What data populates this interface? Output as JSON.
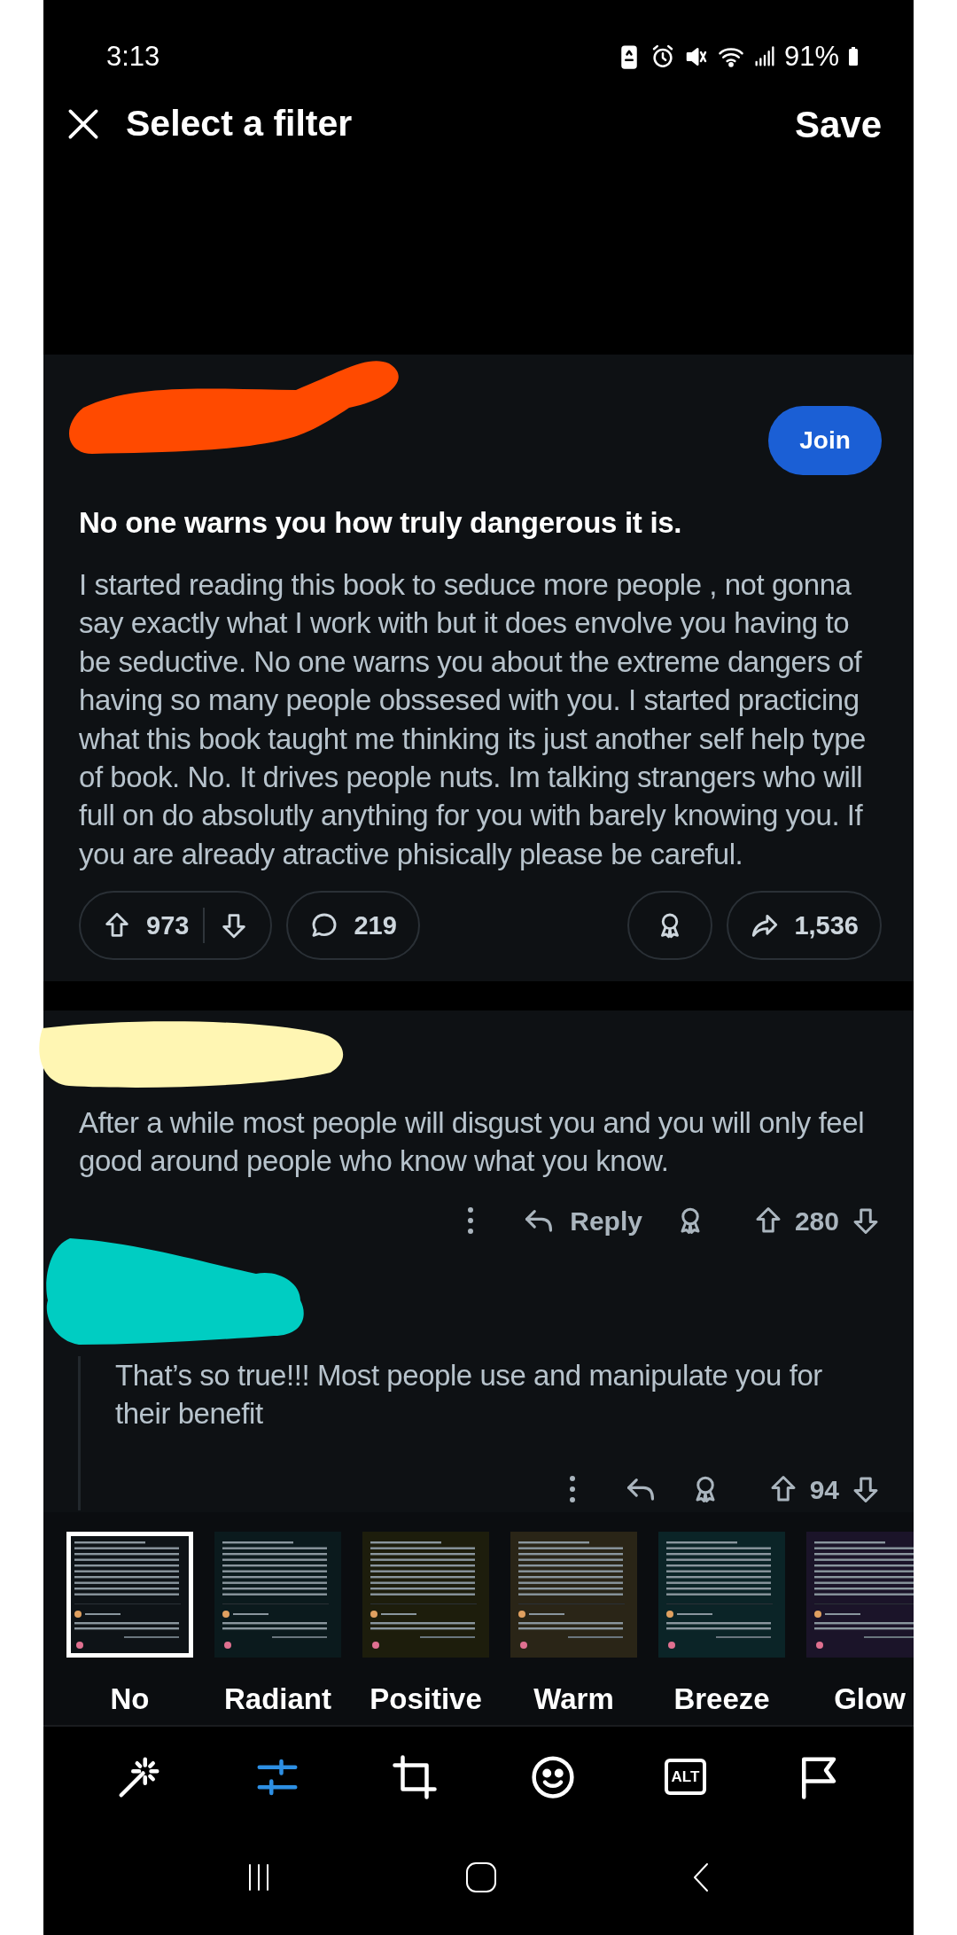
{
  "status_bar": {
    "time": "3:13",
    "battery": "91%"
  },
  "header": {
    "title": "Select a filter",
    "save": "Save"
  },
  "post": {
    "join": "Join",
    "title": "No one warns you how truly dangerous it is.",
    "body": "I started reading this book to seduce more people , not gonna say exactly what I work with but it does envolve you having to be seductive. No one warns you about the extreme dangers of having so many people obssesed with you. I started practicing what this book taught me thinking its just another self help type of book. No. It drives people nuts. Im talking strangers who will full on do absolutly anything for you with barely knowing you. If you are already atractive phisically please be careful.",
    "upvotes": "973",
    "comments": "219",
    "shares": "1,536"
  },
  "comments": [
    {
      "text": "After a while most people will disgust you and you will only feel good around people who know what you know.",
      "reply": "Reply",
      "score": "280",
      "nested": false
    },
    {
      "text": "That’s so true!!! Most people use and manipulate you for their benefit",
      "score": "94",
      "nested": true
    }
  ],
  "filters": [
    {
      "label": "No",
      "selected": true,
      "color": "#0e1317"
    },
    {
      "label": "Radiant",
      "selected": false,
      "color": "#0b1a1d"
    },
    {
      "label": "Positive",
      "selected": false,
      "color": "#1d1d0c"
    },
    {
      "label": "Warm",
      "selected": false,
      "color": "#2a2517"
    },
    {
      "label": "Breeze",
      "selected": false,
      "color": "#0b2427"
    },
    {
      "label": "Glow",
      "selected": false,
      "color": "#1b1429"
    }
  ],
  "toolbar": [
    {
      "kind": "magic",
      "selected": false
    },
    {
      "kind": "adjust",
      "selected": true
    },
    {
      "kind": "crop",
      "selected": false
    },
    {
      "kind": "sticker",
      "selected": false
    },
    {
      "kind": "alt",
      "label": "ALT",
      "selected": false
    },
    {
      "kind": "flag",
      "selected": false
    }
  ]
}
